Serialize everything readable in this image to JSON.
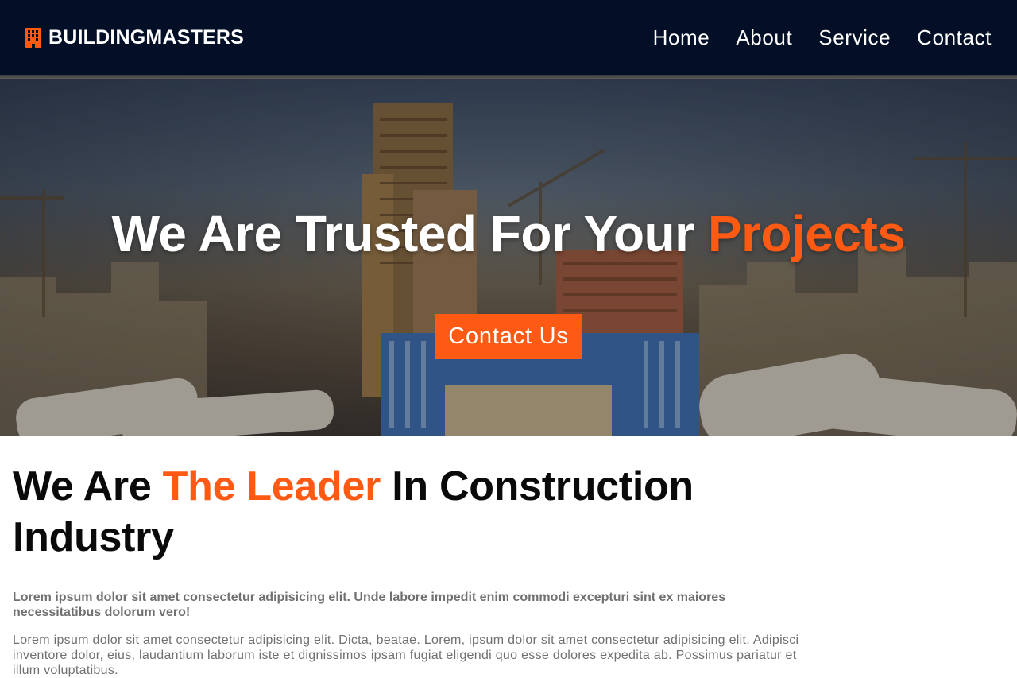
{
  "brand": {
    "icon": "building-icon",
    "name": "BUILDINGMASTERS"
  },
  "nav": {
    "items": [
      {
        "label": "Home"
      },
      {
        "label": "About"
      },
      {
        "label": "Service"
      },
      {
        "label": "Contact"
      }
    ]
  },
  "hero": {
    "title_main": "We Are Trusted For Your ",
    "title_accent": "Projects",
    "button_label": "Contact Us"
  },
  "about": {
    "title_prefix": "We Are ",
    "title_accent": "The Leader",
    "title_suffix": " In Construction Industry",
    "lead": "Lorem ipsum dolor sit amet consectetur adipisicing elit. Unde labore impedit enim commodi excepturi sint ex maiores necessitatibus dolorum vero!",
    "body": "Lorem ipsum dolor sit amet consectetur adipisicing elit. Dicta, beatae. Lorem, ipsum dolor sit amet consectetur adipisicing elit. Adipisci inventore dolor, eius, laudantium laborum iste et dignissimos ipsam fugiat eligendi quo esse dolores expedita ab. Possimus pariatur et illum voluptatibus."
  },
  "colors": {
    "navbar": "#020f26",
    "accent": "#ff5a14",
    "text_dark": "#0a0a0a",
    "text_muted": "#707070"
  }
}
